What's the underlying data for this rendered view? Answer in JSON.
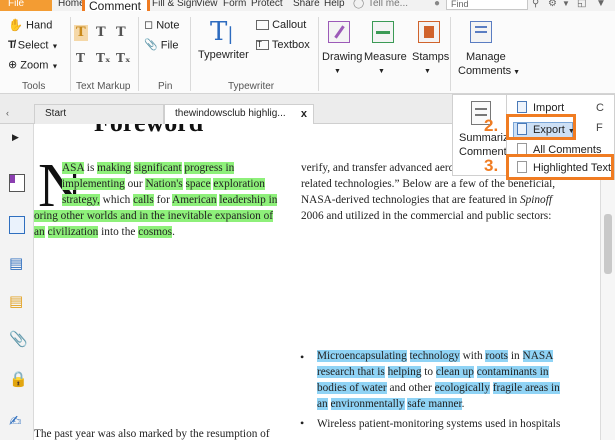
{
  "menubar": {
    "file": "File",
    "home": "Home",
    "comment": "Comment",
    "fill_sign": "Fill & Sign",
    "view": "View",
    "form": "Form",
    "protect": "Protect",
    "share": "Share",
    "help": "Help",
    "tell_me": "Tell me...",
    "search_placeholder": "Find"
  },
  "ribbon": {
    "hand": "Hand",
    "select": "Select",
    "zoom": "Zoom",
    "tools_label": "Tools",
    "text_markup_label": "Text Markup",
    "note": "Note",
    "file": "File",
    "pin_label": "Pin",
    "typewriter": "Typewriter",
    "callout": "Callout",
    "textbox": "Textbox",
    "typewriter_label": "Typewriter",
    "drawing": "Drawing",
    "measure": "Measure",
    "stamps": "Stamps",
    "manage_comments_1": "Manage",
    "manage_comments_2": "Comments",
    "summarize_1": "Summarize",
    "summarize_2": "Comments"
  },
  "dropdown": {
    "import": "Import",
    "export": "Export",
    "all_comments": "All Comments",
    "highlighted_text": "Highlighted Text",
    "step2": "2.",
    "step3": "3."
  },
  "tabs": [
    {
      "label": "Start"
    },
    {
      "label": "thewindowsclub highlig...",
      "close": "x"
    }
  ],
  "document": {
    "heading": "Foreword",
    "dropcap": "N",
    "left_lines": [
      {
        "parts": [
          {
            "t": "ASA",
            "h": "g"
          },
          {
            "t": " is "
          },
          {
            "t": "making",
            "h": "g"
          },
          {
            "t": " "
          },
          {
            "t": "significant",
            "h": "g"
          },
          {
            "t": " "
          },
          {
            "t": "progress",
            "h": "g"
          },
          {
            "t": " in",
            "h": "g"
          }
        ]
      },
      {
        "parts": [
          {
            "t": "implementing",
            "h": "g"
          },
          {
            "t": " our "
          },
          {
            "t": "Nation's",
            "h": "g"
          },
          {
            "t": " "
          },
          {
            "t": "space",
            "h": "g"
          },
          {
            "t": " "
          },
          {
            "t": "exploration",
            "h": "g"
          }
        ]
      },
      {
        "parts": [
          {
            "t": "strategy,",
            "h": "g"
          },
          {
            "t": " which "
          },
          {
            "t": "calls",
            "h": "g"
          },
          {
            "t": " for "
          },
          {
            "t": "American",
            "h": "g"
          },
          {
            "t": " "
          },
          {
            "t": "leadership",
            "h": "g"
          },
          {
            "t": " in",
            "h": "g"
          }
        ]
      },
      {
        "parts": [
          {
            "t": "oring other worlds and in the inevitable expansion of",
            "h": "g"
          }
        ]
      },
      {
        "parts": [
          {
            "t": "an",
            "h": "g"
          },
          {
            "t": " "
          },
          {
            "t": "civilization",
            "h": "g"
          },
          {
            "t": " into the "
          },
          {
            "t": "cosmos",
            "h": "g"
          },
          {
            "t": "."
          }
        ]
      }
    ],
    "right_lines": [
      "verify, and transfer advanced aeronautics and space",
      "related technologies.” Below are a few of the beneficial,",
      "NASA-derived technologies that are featured in Spinoff",
      "2006 and utilized in the commercial and public sectors:"
    ],
    "bullet1_lines": [
      {
        "parts": [
          {
            "t": "Microencapsulating",
            "h": "b"
          },
          {
            "t": " "
          },
          {
            "t": "technology",
            "h": "b"
          },
          {
            "t": " with "
          },
          {
            "t": "roots",
            "h": "b"
          },
          {
            "t": " in "
          },
          {
            "t": "NASA",
            "h": "b"
          }
        ]
      },
      {
        "parts": [
          {
            "t": "research that is",
            "h": "b"
          },
          {
            "t": " "
          },
          {
            "t": "helping",
            "h": "b"
          },
          {
            "t": " to "
          },
          {
            "t": "clean up",
            "h": "b"
          },
          {
            "t": " "
          },
          {
            "t": "contaminants in",
            "h": "b"
          }
        ]
      },
      {
        "parts": [
          {
            "t": "bodies of water",
            "h": "b"
          },
          {
            "t": " and other "
          },
          {
            "t": "ecologically",
            "h": "b"
          },
          {
            "t": " "
          },
          {
            "t": "fragile areas in",
            "h": "b"
          }
        ]
      },
      {
        "parts": [
          {
            "t": "an",
            "h": "b"
          },
          {
            "t": " "
          },
          {
            "t": "environmentally",
            "h": "b"
          },
          {
            "t": " "
          },
          {
            "t": "safe manner",
            "h": "b"
          },
          {
            "t": "."
          }
        ]
      }
    ],
    "bullet2_lines": [
      "Wireless patient-monitoring systems used in hospitals",
      "…"
    ],
    "bottom_left": "The past year was also marked by the resumption of"
  },
  "colors": {
    "accent": "#f07c22",
    "highlight_green": "#8ef07a",
    "highlight_blue": "#8fd3f5",
    "file_tab": "#f39c33"
  },
  "icons": [
    "hand-icon",
    "select-icon",
    "zoom-icon",
    "note-icon",
    "file-icon",
    "typewriter-icon",
    "callout-icon",
    "textbox-icon",
    "drawing-icon",
    "measure-icon",
    "stamps-icon",
    "manage-comments-icon",
    "import-icon",
    "export-icon",
    "highlighted-text-icon"
  ]
}
